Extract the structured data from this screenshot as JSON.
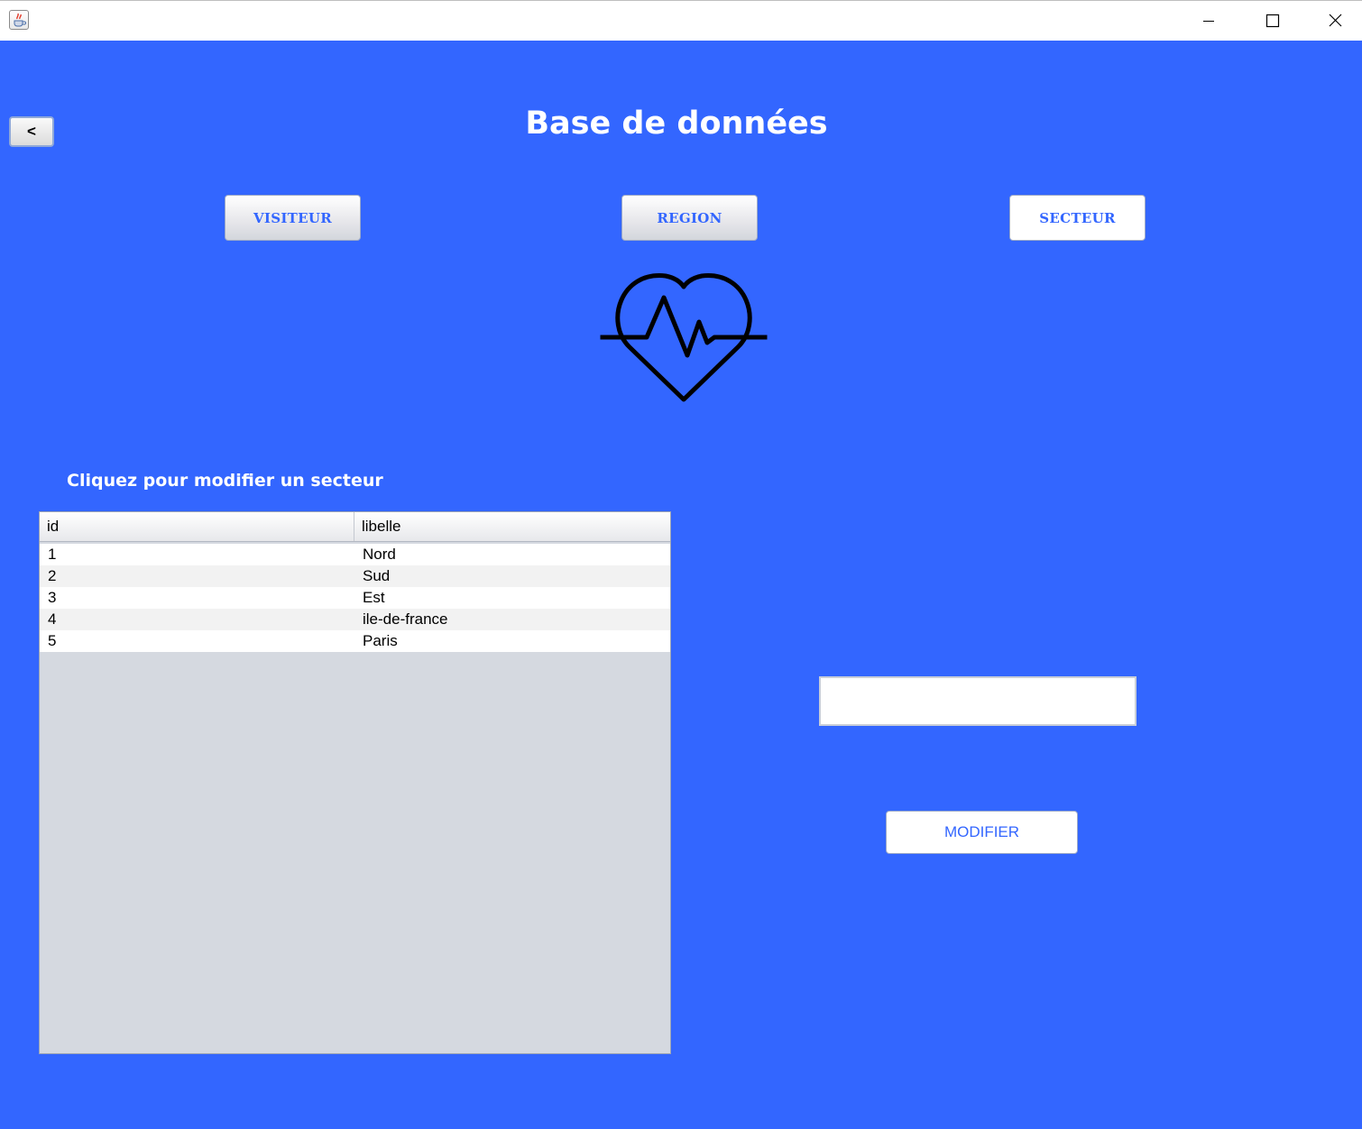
{
  "window": {
    "app_icon": "java-cup-icon",
    "controls": [
      "minimize-icon",
      "maximize-icon",
      "close-icon"
    ]
  },
  "back_button": {
    "label": "<"
  },
  "page_title": "Base de données",
  "nav": {
    "visiteur": "VISITEUR",
    "region": "REGION",
    "secteur": "SECTEUR"
  },
  "logo": {
    "icon": "heart-pulse-icon"
  },
  "table": {
    "caption": "Cliquez pour modifier un secteur",
    "columns": [
      "id",
      "libelle"
    ],
    "rows": [
      [
        "1",
        "Nord"
      ],
      [
        "2",
        "Sud"
      ],
      [
        "3",
        "Est"
      ],
      [
        "4",
        "ile-de-france"
      ],
      [
        "5",
        "Paris"
      ]
    ]
  },
  "edit": {
    "value": "",
    "button_label": "MODIFIER"
  },
  "colors": {
    "background": "#3366ff",
    "accent_text": "#3366ff",
    "title_text": "#ffffff"
  }
}
